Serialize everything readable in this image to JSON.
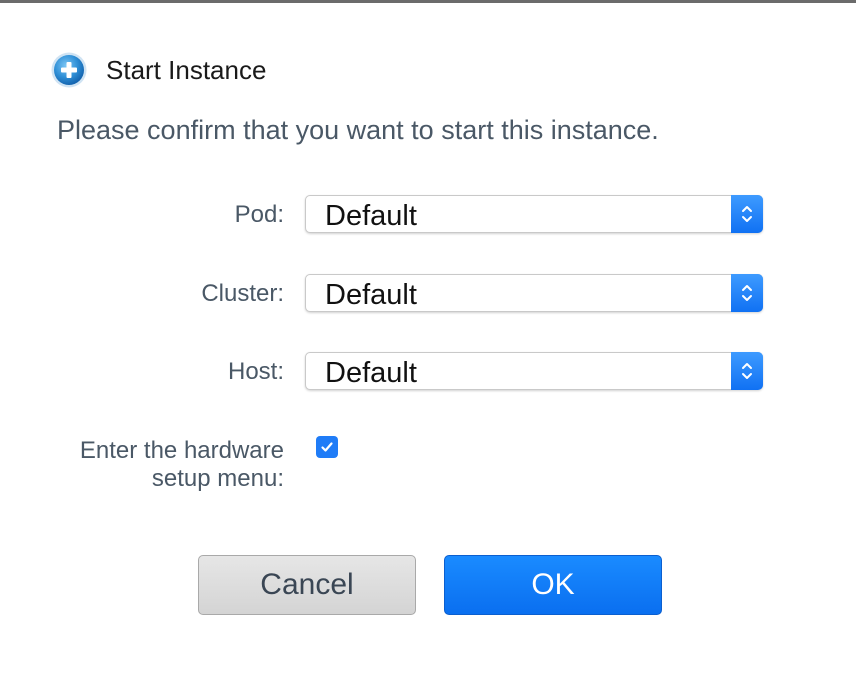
{
  "dialog": {
    "title": "Start Instance",
    "title_icon": "plus-circle-icon",
    "message": "Please confirm that you want to start this instance."
  },
  "form": {
    "pod": {
      "label": "Pod:",
      "value": "Default"
    },
    "cluster": {
      "label": "Cluster:",
      "value": "Default"
    },
    "host": {
      "label": "Host:",
      "value": "Default"
    },
    "hardware_setup": {
      "label_line1": "Enter the hardware",
      "label_line2": "setup menu:",
      "checked": true
    }
  },
  "buttons": {
    "cancel_label": "Cancel",
    "ok_label": "OK"
  },
  "colors": {
    "accent": "#1a8bff",
    "label_text": "#4a5866",
    "cancel_bg": "#dcdcdc"
  }
}
